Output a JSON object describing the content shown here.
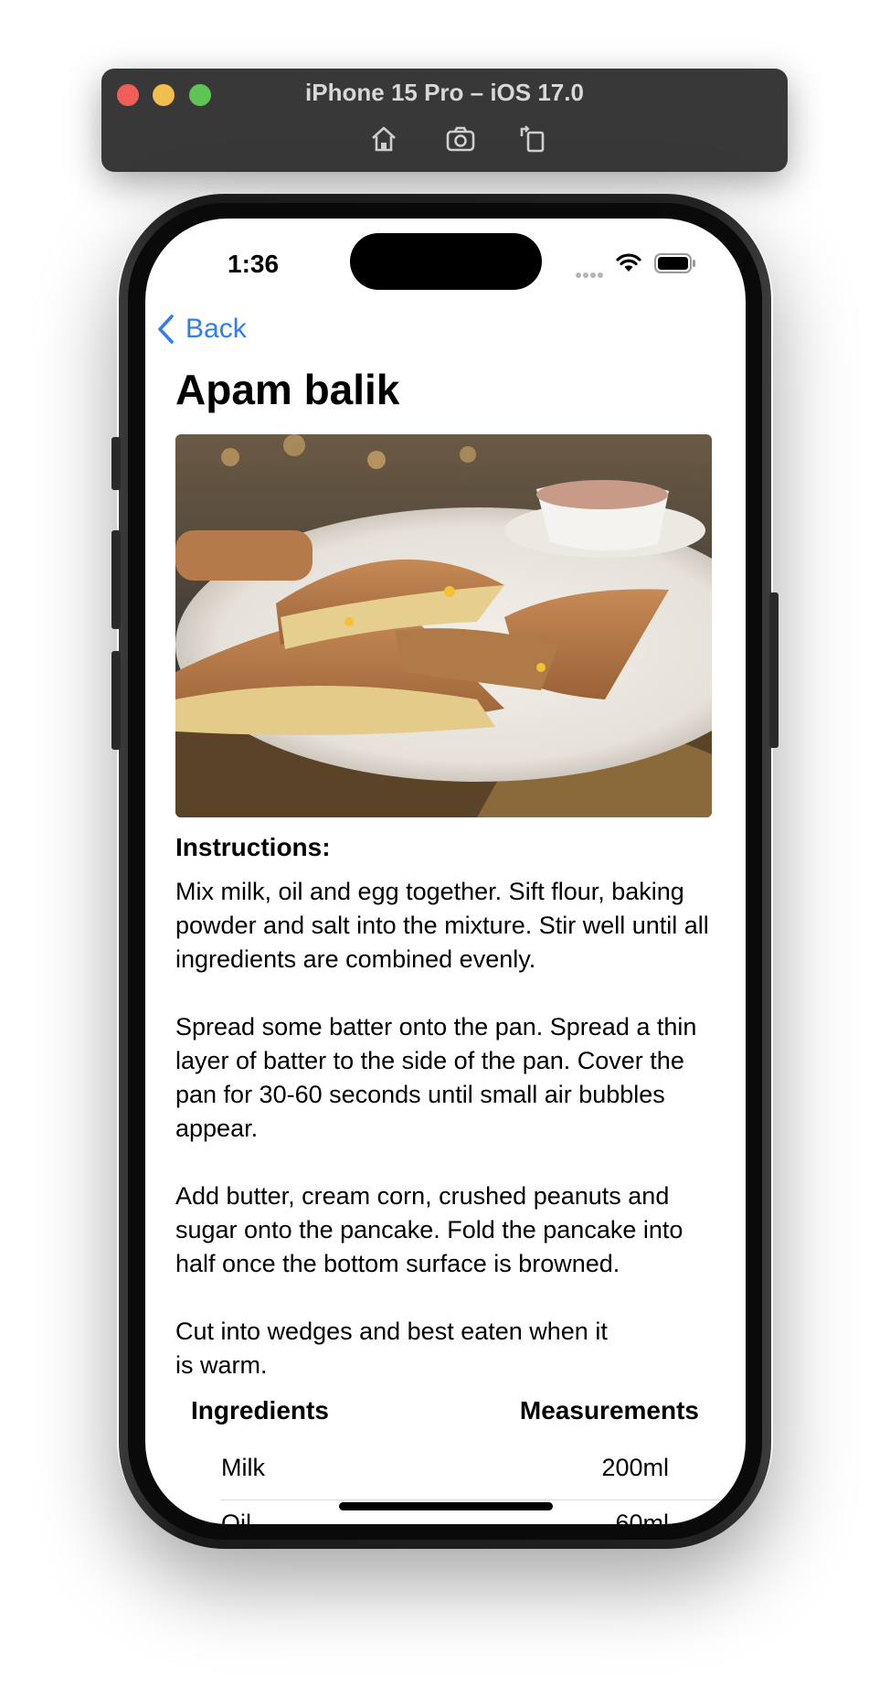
{
  "simulator": {
    "title": "iPhone 15 Pro – iOS 17.0",
    "icons": [
      "home-icon",
      "screenshot-icon",
      "rotate-icon"
    ]
  },
  "status_bar": {
    "time": "1:36"
  },
  "nav": {
    "back_label": "Back"
  },
  "recipe": {
    "title": "Apam balik",
    "image_description": "apam-balik-photo",
    "instructions_heading": "Instructions:",
    "instructions": "Mix milk, oil and egg together. Sift flour, baking powder and salt into the mixture. Stir well until all ingredients are combined evenly.\n\nSpread some batter onto the pan. Spread a thin layer of batter to the side of the pan. Cover the pan for 30-60 seconds until small air bubbles appear.\n\nAdd butter, cream corn, crushed peanuts and sugar onto the pancake. Fold the pancake into half once the bottom surface is browned.\n\nCut into wedges and best eaten when it\nis warm."
  },
  "ingredients_table": {
    "header_name": "Ingredients",
    "header_measure": "Measurements",
    "rows": [
      {
        "name": "Milk",
        "amount": "200ml"
      },
      {
        "name": "Oil",
        "amount": "60ml"
      }
    ]
  },
  "colors": {
    "accent": "#2f7cf6",
    "toolbar": "#383838"
  }
}
